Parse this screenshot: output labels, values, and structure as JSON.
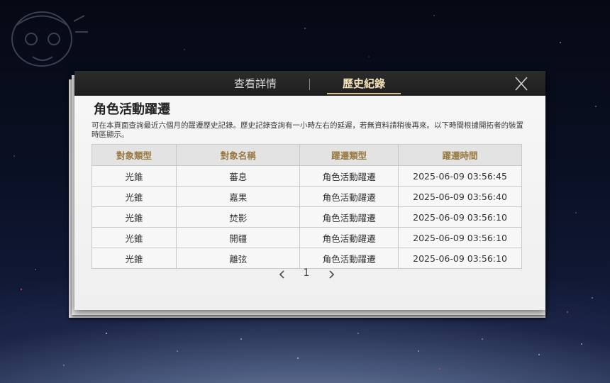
{
  "tabs": [
    {
      "label": "查看詳情",
      "active": false
    },
    {
      "label": "歷史紀錄",
      "active": true
    }
  ],
  "panel": {
    "title": "角色活動躍遷",
    "description": "可在本頁面查詢最近六個月的躍遷歷史記錄。歷史記錄查詢有一小時左右的延遲，若無資料請稍後再來。以下時間根據開拓者的裝置時區顯示。"
  },
  "table": {
    "headers": [
      "對象類型",
      "對象名稱",
      "躍遷類型",
      "躍遷時間"
    ],
    "rows": [
      [
        "光錐",
        "蕃息",
        "角色活動躍遷",
        "2025-06-09 03:56:45"
      ],
      [
        "光錐",
        "嘉果",
        "角色活動躍遷",
        "2025-06-09 03:56:40"
      ],
      [
        "光錐",
        "焚影",
        "角色活動躍遷",
        "2025-06-09 03:56:10"
      ],
      [
        "光錐",
        "開疆",
        "角色活動躍遷",
        "2025-06-09 03:56:10"
      ],
      [
        "光錐",
        "離弦",
        "角色活動躍遷",
        "2025-06-09 03:56:10"
      ]
    ]
  },
  "pagination": {
    "current_page": "1",
    "prev_icon": "chevron-left-icon",
    "next_icon": "chevron-right-icon"
  },
  "icons": {
    "close": "close-icon"
  },
  "colors": {
    "accent_gold": "#d8c08a",
    "header_text": "#9a7a43",
    "topbar": "#1e1e1e"
  }
}
